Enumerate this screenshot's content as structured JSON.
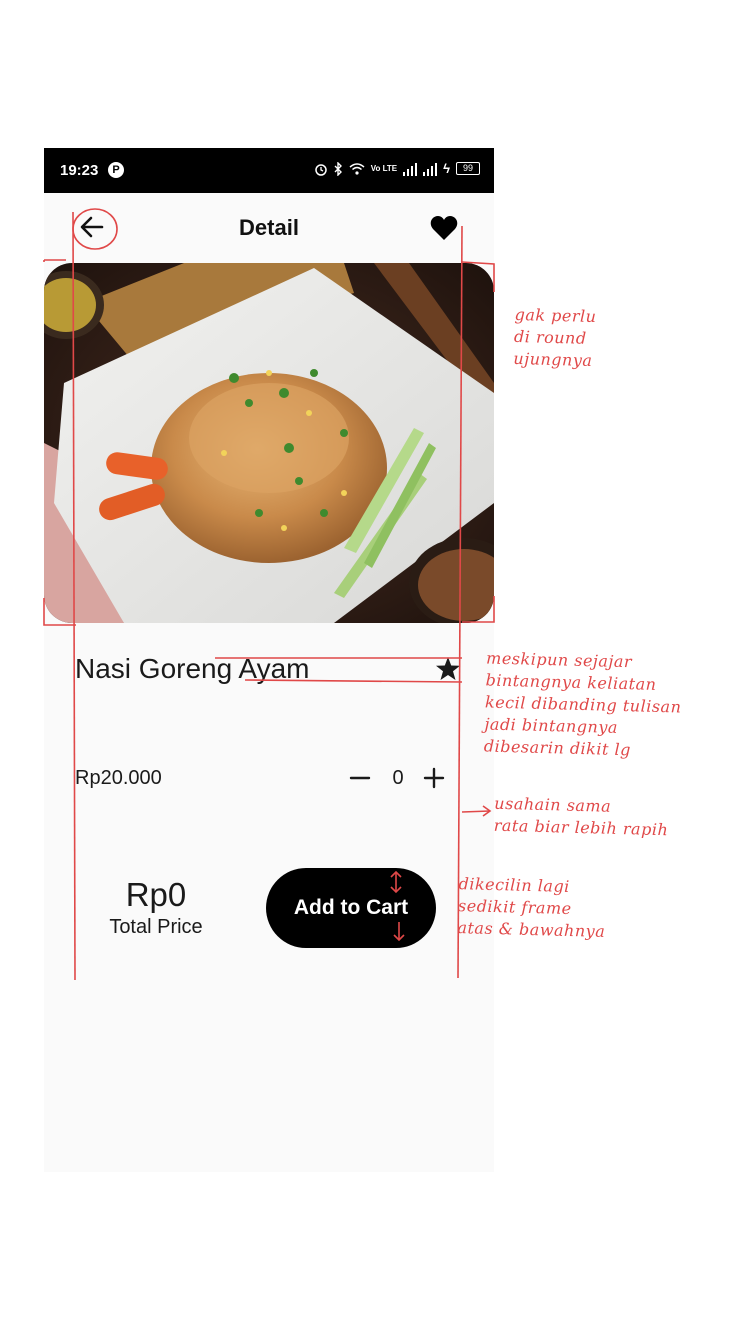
{
  "status_bar": {
    "time": "19:23",
    "app_icon_letter": "P",
    "network_label": "Vo LTE",
    "battery": "99"
  },
  "app_bar": {
    "title": "Detail",
    "back_icon": "arrow-back-icon",
    "favorite_icon": "heart-icon"
  },
  "product": {
    "name": "Nasi Goreng Ayam",
    "price": "Rp20.000",
    "quantity": "0",
    "rating_icon": "star-icon",
    "image_alt": "fried rice plate"
  },
  "cart": {
    "total_price": "Rp0",
    "total_label": "Total Price",
    "add_to_cart_label": "Add to Cart"
  },
  "annotations": {
    "note_rounding": [
      "gak perlu",
      "di round",
      "ujungnya"
    ],
    "note_star": [
      "meskipun sejajar",
      "bintangnya keliatan",
      "kecil dibanding tulisan",
      "jadi bintangnya",
      "dibesarin dikit lg"
    ],
    "note_align": [
      "usahain sama",
      "rata biar lebih rapih"
    ],
    "note_button": [
      "dikecilin lagi",
      "sedikit frame",
      "atas & bawahnya"
    ]
  },
  "colors": {
    "annotation": "#e04848",
    "status_bar": "#000000",
    "button": "#000000",
    "screen_bg": "#fafafa"
  }
}
